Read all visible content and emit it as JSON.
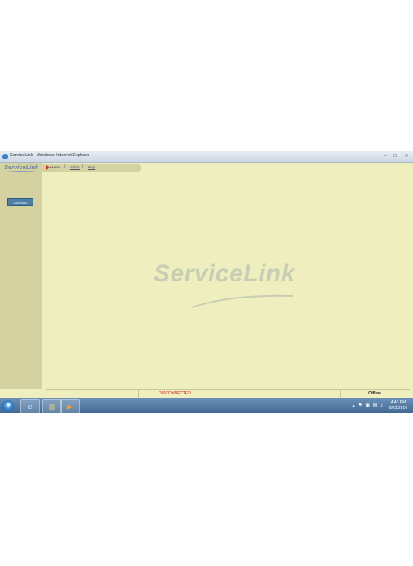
{
  "window": {
    "title": "ServiceLink - Windows Internet Explorer"
  },
  "header": {
    "logo_text": "ServiceLink",
    "nav": [
      {
        "label": "Home"
      },
      {
        "label": "Admin"
      },
      {
        "label": "Help"
      }
    ]
  },
  "sidebar": {
    "connect_label": "Connect"
  },
  "main": {
    "watermark_text": "ServiceLink"
  },
  "statusbar": {
    "cells": [
      "",
      "DISCONNECTED",
      "",
      "Offline"
    ]
  },
  "taskbar": {
    "clock_time": "4:43 PM",
    "clock_date": "8/22/2016"
  },
  "colors": {
    "background": "#efeebf",
    "sidebar": "#d3d2a0",
    "disconnected": "#cc1f1f",
    "connect_button": "#4d7ea8"
  }
}
